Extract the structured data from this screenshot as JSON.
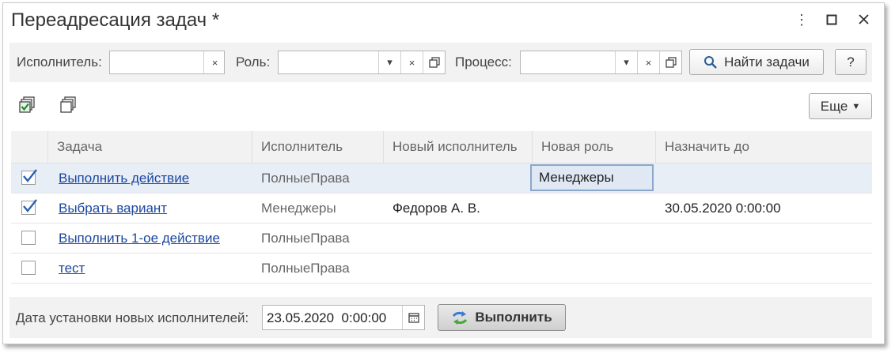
{
  "window": {
    "title": "Переадресация задач *"
  },
  "filters": {
    "executor_label": "Исполнитель:",
    "executor_value": "",
    "role_label": "Роль:",
    "role_value": "",
    "process_label": "Процесс:",
    "process_value": "",
    "clear_glyph": "×",
    "dropdown_glyph": "▾",
    "find_button": "Найти задачи",
    "help_button": "?"
  },
  "toolbar": {
    "more_button": "Еще"
  },
  "grid": {
    "columns": [
      "Задача",
      "Исполнитель",
      "Новый исполнитель",
      "Новая роль",
      "Назначить до"
    ],
    "rows": [
      {
        "checked": true,
        "task": "Выполнить действие",
        "executor": "ПолныеПрава",
        "new_executor": "",
        "new_role": "Менеджеры",
        "assign_until": ""
      },
      {
        "checked": true,
        "task": "Выбрать вариант",
        "executor": "Менеджеры",
        "new_executor": "Федоров А. В.",
        "new_role": "",
        "assign_until": "30.05.2020 0:00:00"
      },
      {
        "checked": false,
        "task": "Выполнить 1-ое действие",
        "executor": "ПолныеПрава",
        "new_executor": "",
        "new_role": "",
        "assign_until": ""
      },
      {
        "checked": false,
        "task": "тест",
        "executor": "ПолныеПрава",
        "new_executor": "",
        "new_role": "",
        "assign_until": ""
      }
    ]
  },
  "bottom": {
    "date_label": "Дата установки новых исполнителей:",
    "date_value": "23.05.2020  0:00:00",
    "execute_button": "Выполнить"
  },
  "colors": {
    "link": "#1b46a0",
    "selected_row": "#e8eef6",
    "panel": "#f2f2f2",
    "check": "#2a62b0"
  }
}
